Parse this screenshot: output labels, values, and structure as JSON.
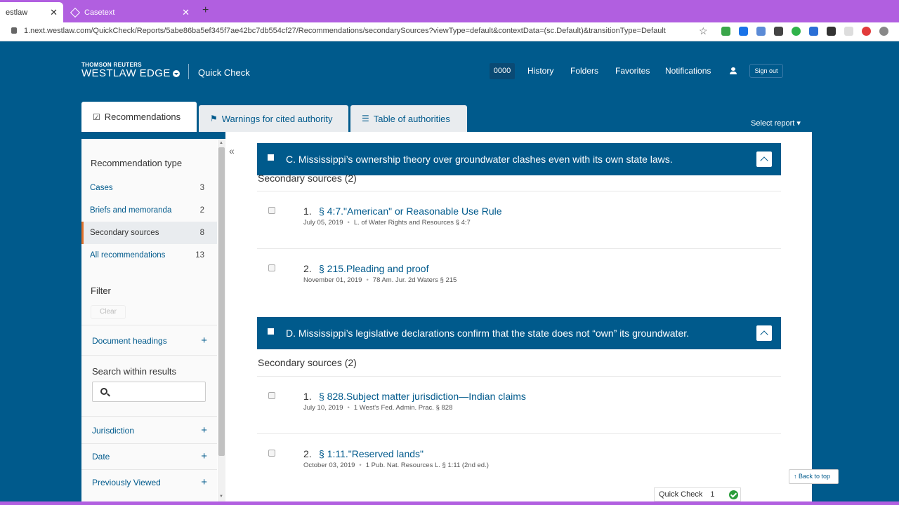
{
  "browser": {
    "tabs": [
      {
        "label": "estlaw",
        "close": "✕"
      },
      {
        "label": "Casetext",
        "close": "✕"
      }
    ],
    "new_tab": "+",
    "url": "1.next.westlaw.com/QuickCheck/Reports/5abe86ba5ef345f7ae42bc7db554cf27/Recommendations/secondarySources?viewType=default&contextData=(sc.Default)&transitionType=Default",
    "star": "☆"
  },
  "header": {
    "brand_small": "THOMSON REUTERS",
    "brand_big": "WESTLAW EDGE",
    "product": "Quick Check",
    "client_id": "0000",
    "nav": [
      "History",
      "Folders",
      "Favorites",
      "Notifications"
    ],
    "sign_out": "Sign out"
  },
  "report_tabs": [
    {
      "label": "Recommendations",
      "icon": "☑"
    },
    {
      "label": "Warnings for cited authority",
      "icon": "⚑"
    },
    {
      "label": "Table of authorities",
      "icon": "☰"
    }
  ],
  "select_report": "Select report ▾",
  "sidebar": {
    "collapse": "«",
    "type_heading": "Recommendation type",
    "types": [
      {
        "label": "Cases",
        "count": "3"
      },
      {
        "label": "Briefs and memoranda",
        "count": "2"
      },
      {
        "label": "Secondary sources",
        "count": "8"
      },
      {
        "label": "All recommendations",
        "count": "13"
      }
    ],
    "filter_heading": "Filter",
    "clear": "Clear",
    "document_headings": "Document headings",
    "search_heading": "Search within results",
    "filters": [
      "Jurisdiction",
      "Date",
      "Previously Viewed"
    ],
    "plus": "+"
  },
  "sections": [
    {
      "heading": "C. Mississippi’s ownership theory over groundwater clashes even with its own state laws.",
      "subheading": "Secondary sources (2)",
      "results": [
        {
          "num": "1.",
          "title": "§ 4:7.\"American\" or Reasonable Use Rule",
          "date": "July 05, 2019",
          "source": "L. of Water Rights and Resources § 4:7"
        },
        {
          "num": "2.",
          "title": "§ 215.Pleading and proof",
          "date": "November 01, 2019",
          "source": "78 Am. Jur. 2d Waters § 215"
        }
      ]
    },
    {
      "heading": "D. Mississippi’s legislative declarations confirm that the state does not “own” its groundwater.",
      "subheading": "Secondary sources (2)",
      "results": [
        {
          "num": "1.",
          "title": "§ 828.Subject matter jurisdiction—Indian claims",
          "date": "July 10, 2019",
          "source": "1 West's Fed. Admin. Prac. § 828"
        },
        {
          "num": "2.",
          "title": "§ 1:11.\"Reserved lands\"",
          "date": "October 03, 2019",
          "source": "1 Pub. Nat. Resources L. § 1:11 (2nd ed.)"
        }
      ]
    }
  ],
  "meta_dot": "•",
  "back_to_top": "Back to top",
  "quick_check": {
    "label": "Quick Check",
    "count": "1"
  },
  "colors": {
    "brand": "#005a8c",
    "tabbar": "#b15fe0",
    "accent": "#e0702a",
    "success": "#2a9d3a"
  }
}
